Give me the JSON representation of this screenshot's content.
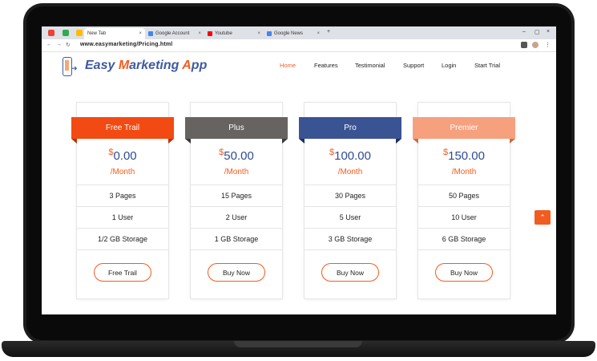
{
  "browser": {
    "tabs": [
      {
        "label": "New Tab",
        "favicon_color": "#4285f4"
      },
      {
        "label": "Google Account",
        "favicon_color": "#4285f4"
      },
      {
        "label": "Youtube",
        "favicon_color": "#ff0000"
      },
      {
        "label": "Google News",
        "favicon_color": "#4285f4"
      }
    ],
    "pinned_colors": [
      "#ea4335",
      "#34a853",
      "#fbbc05"
    ],
    "new_tab_label": "+",
    "url": "www.easymarketing/Pricing.html",
    "minimize_label": "–",
    "maximize_label": "▢",
    "close_label": "×",
    "back_label": "←",
    "forward_label": "→",
    "reload_label": "↻",
    "lock_label": "⚲"
  },
  "site": {
    "logo_part1": "Easy ",
    "logo_part2": "M",
    "logo_part3": "arketing ",
    "logo_part4": "A",
    "logo_part5": "pp",
    "nav": [
      "Home",
      "Features",
      "Testimonial",
      "Support",
      "Login",
      "Start Trial"
    ],
    "active_nav": "Home",
    "accent_color": "#f25c21",
    "brand_color": "#3e5aa0"
  },
  "plans": [
    {
      "name": "Free Trail",
      "currency": "$",
      "price": "0.00",
      "period": "/Month",
      "features": [
        "3 Pages",
        "1 User",
        "1/2 GB Storage"
      ],
      "button": "Free Trail",
      "color": "#f24a12",
      "fold_color": "#b2330a"
    },
    {
      "name": "Plus",
      "currency": "$",
      "price": "50.00",
      "period": "/Month",
      "features": [
        "15 Pages",
        "2 User",
        "1 GB Storage"
      ],
      "button": "Buy Now",
      "color": "#666361",
      "fold_color": "#3a3938"
    },
    {
      "name": "Pro",
      "currency": "$",
      "price": "100.00",
      "period": "/Month",
      "features": [
        "30 Pages",
        "5 User",
        "3 GB Storage"
      ],
      "button": "Buy Now",
      "color": "#3a5393",
      "fold_color": "#1e2e5e"
    },
    {
      "name": "Premier",
      "currency": "$",
      "price": "150.00",
      "period": "/Month",
      "features": [
        "50 Pages",
        "10 User",
        "6 GB Storage"
      ],
      "button": "Buy Now",
      "color": "#f6a07e",
      "fold_color": "#c3704c"
    }
  ],
  "scroll_top_label": "⌃"
}
